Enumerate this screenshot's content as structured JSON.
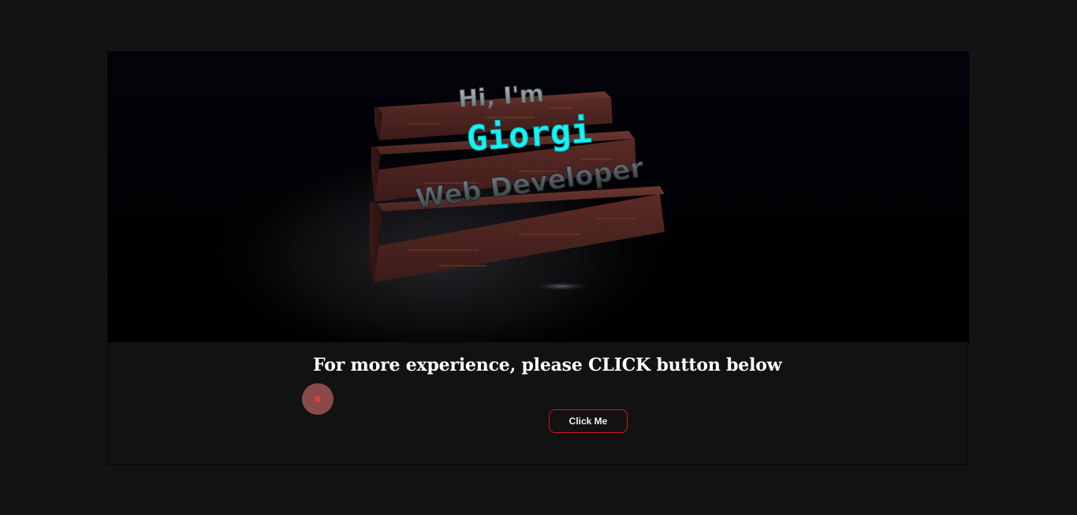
{
  "scene": {
    "line1": "Hi, I'm",
    "name": "Giorgi",
    "role": "Web Developer"
  },
  "headline": "For more experience, please CLICK button below",
  "cta_label": "Click Me",
  "colors": {
    "page_bg": "#131313",
    "panel_bg": "#121212",
    "name_accent": "#17f2f2",
    "button_border": "#d11a1a",
    "wood": "#5a2a24",
    "cursor": "#e03d3d"
  }
}
